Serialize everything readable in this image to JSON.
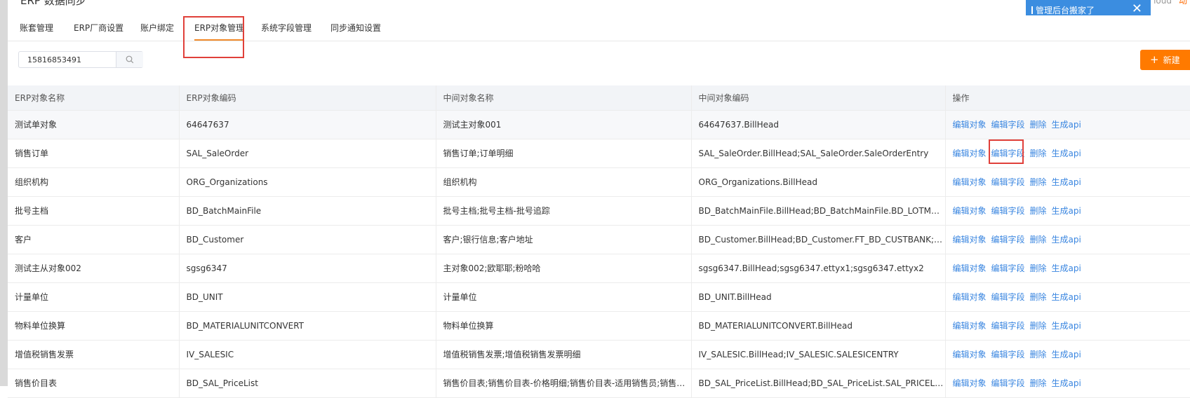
{
  "app": {
    "title": "ERP 数据同步",
    "top_right_text": "loud",
    "top_right_extra": "动"
  },
  "toast": {
    "text": "管理后台搬家了",
    "close_icon": "close-icon"
  },
  "tabs": [
    {
      "label": "账套管理",
      "active": false
    },
    {
      "label": "ERP厂商设置",
      "active": false
    },
    {
      "label": "账户绑定",
      "active": false
    },
    {
      "label": "ERP对象管理",
      "active": true
    },
    {
      "label": "系统字段管理",
      "active": false
    },
    {
      "label": "同步通知设置",
      "active": false
    }
  ],
  "search": {
    "value": "15816853491",
    "placeholder": "",
    "icon": "search-icon"
  },
  "actions": {
    "new_label": "新建",
    "new_icon": "plus-icon"
  },
  "table": {
    "columns": [
      "ERP对象名称",
      "ERP对象编码",
      "中间对象名称",
      "中间对象编码",
      "操作"
    ],
    "operations": [
      "编辑对象",
      "编辑字段",
      "删除",
      "生成api"
    ],
    "rows": [
      [
        "测试单对象",
        "64647637",
        "测试主对象001",
        "64647637.BillHead"
      ],
      [
        "销售订单",
        "SAL_SaleOrder",
        "销售订单;订单明细",
        "SAL_SaleOrder.BillHead;SAL_SaleOrder.SaleOrderEntry"
      ],
      [
        "组织机构",
        "ORG_Organizations",
        "组织机构",
        "ORG_Organizations.BillHead"
      ],
      [
        "批号主档",
        "BD_BatchMainFile",
        "批号主档;批号主档-批号追踪",
        "BD_BatchMainFile.BillHead;BD_BatchMainFile.BD_LOTMASTERBILLTR..."
      ],
      [
        "客户",
        "BD_Customer",
        "客户;银行信息;客户地址",
        "BD_Customer.BillHead;BD_Customer.FT_BD_CUSTBANK;BD_Custome..."
      ],
      [
        "测试主从对象002",
        "sgsg6347",
        "主对象002;欧耶耶;粉哈哈",
        "sgsg6347.BillHead;sgsg6347.ettyx1;sgsg6347.ettyx2"
      ],
      [
        "计量单位",
        "BD_UNIT",
        "计量单位",
        "BD_UNIT.BillHead"
      ],
      [
        "物料单位换算",
        "BD_MATERIALUNITCONVERT",
        "物料单位换算",
        "BD_MATERIALUNITCONVERT.BillHead"
      ],
      [
        "增值税销售发票",
        "IV_SALESIC",
        "增值税销售发票;增值税销售发票明细",
        "IV_SALESIC.BillHead;IV_SALESIC.SALESICENTRY"
      ],
      [
        "销售价目表",
        "BD_SAL_PriceList",
        "销售价目表;销售价目表-价格明细;销售价目表-适用销售员;销售价目表",
        "BD_SAL_PriceList.BillHead;BD_SAL_PriceList.SAL_PRICELISTENTRY;B"
      ]
    ]
  },
  "colors": {
    "accent": "#ff7a00",
    "link": "#3a86e0",
    "toast": "#3b8de0",
    "highlight": "#e0403a"
  }
}
